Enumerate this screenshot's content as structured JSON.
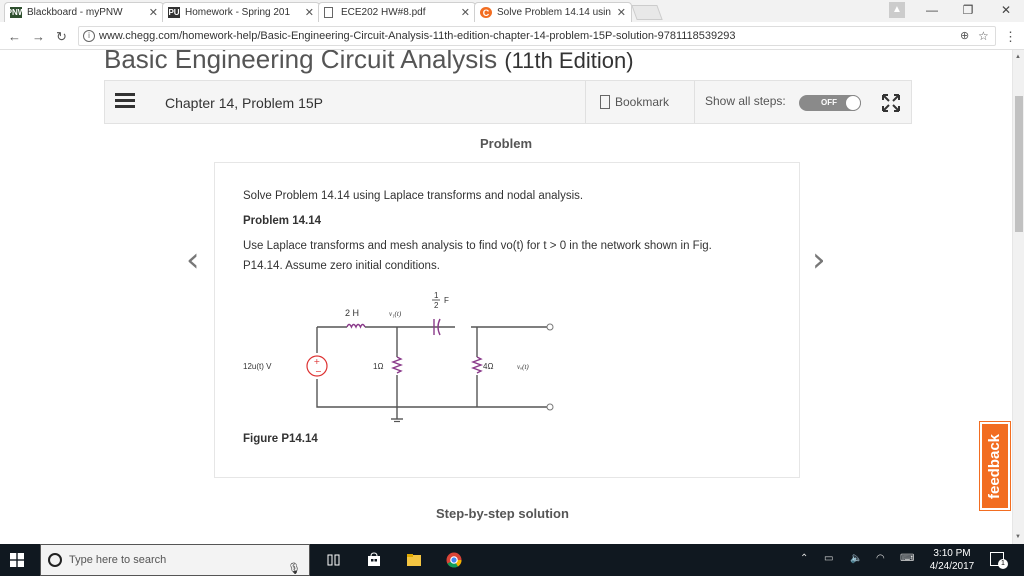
{
  "browser": {
    "tabs": [
      {
        "title": "Blackboard - myPNW",
        "icon": "blackboard-favicon",
        "color": "#2e4f2e"
      },
      {
        "title": "Homework - Spring 201",
        "icon": "homework-favicon",
        "color": "#333333"
      },
      {
        "title": "ECE202 HW#8.pdf",
        "icon": "document-icon",
        "color": "#ffffff"
      },
      {
        "title": "Solve Problem 14.14 usin",
        "icon": "chegg-favicon",
        "color": "#f26d21"
      }
    ],
    "url": "www.chegg.com/homework-help/Basic-Engineering-Circuit-Analysis-11th-edition-chapter-14-problem-15P-solution-9781118539293"
  },
  "book": {
    "title": "Basic Engineering Circuit Analysis",
    "edition": "(11th Edition)"
  },
  "chapter_bar": {
    "chapter": "Chapter 14, Problem 15P",
    "bookmark_label": "Bookmark",
    "steps_label": "Show all steps:",
    "toggle_label": "OFF"
  },
  "problem": {
    "heading": "Problem",
    "line1": "Solve Problem 14.14 using Laplace transforms and nodal analysis.",
    "sub_heading": "Problem 14.14",
    "line2": "Use Laplace transforms and mesh analysis to find vo(t) for t > 0 in the network shown in Fig.",
    "line3": "P14.14. Assume zero initial conditions.",
    "figure_caption": "Figure P14.14"
  },
  "circuit": {
    "inductor": "2 H",
    "v1": "v₁(t)",
    "cap_num": "1",
    "cap_den": "2",
    "cap_unit": "F",
    "source": "12u(t) V",
    "r1": "1Ω",
    "r2": "4Ω",
    "vo": "vₒ(t)"
  },
  "solution_heading": "Step-by-step solution",
  "feedback_label": "feedback",
  "taskbar": {
    "search_placeholder": "Type here to search",
    "time": "3:10 PM",
    "date": "4/24/2017",
    "notification_count": "1"
  }
}
